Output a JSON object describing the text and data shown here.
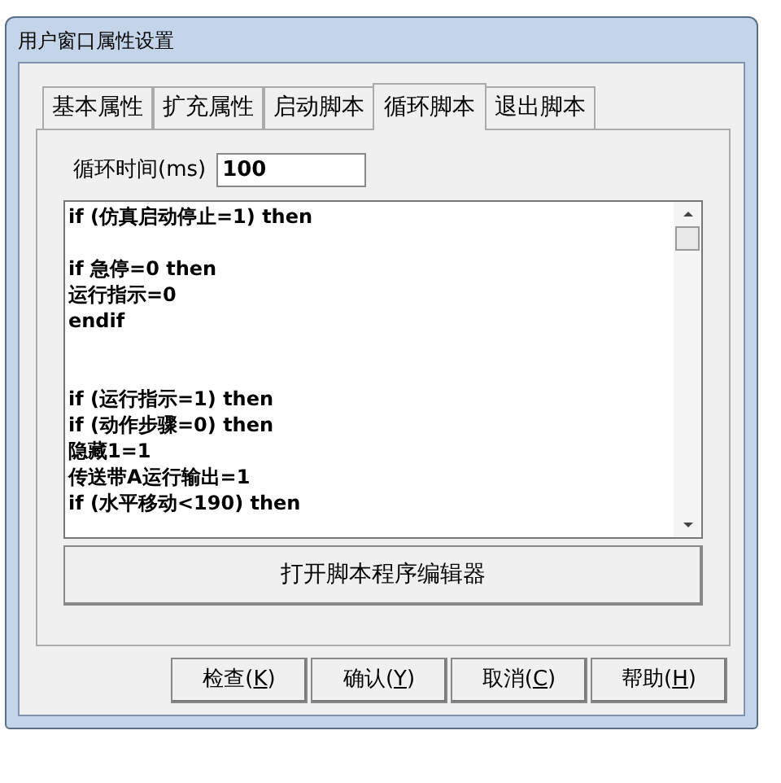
{
  "window": {
    "title": "用户窗口属性设置"
  },
  "tabs": [
    {
      "label": "基本属性",
      "selected": false
    },
    {
      "label": "扩充属性",
      "selected": false
    },
    {
      "label": "启动脚本",
      "selected": false
    },
    {
      "label": "循环脚本",
      "selected": true
    },
    {
      "label": "退出脚本",
      "selected": false
    }
  ],
  "cycle_time": {
    "label": "循环时间(ms)",
    "value": "100"
  },
  "script": "if (仿真启动停止=1) then\n\nif 急停=0 then\n运行指示=0\nendif\n\n\nif (运行指示=1) then\nif (动作步骤=0) then\n隐藏1=1\n传送带A运行输出=1\nif (水平移动<190) then",
  "editor_button": "打开脚本程序编辑器",
  "buttons": [
    {
      "label_start": "检查(",
      "accelerator": "K",
      "label_end": ")"
    },
    {
      "label_start": "确认(",
      "accelerator": "Y",
      "label_end": ")"
    },
    {
      "label_start": "取消(",
      "accelerator": "C",
      "label_end": ")"
    },
    {
      "label_start": "帮助(",
      "accelerator": "H",
      "label_end": ")"
    }
  ]
}
